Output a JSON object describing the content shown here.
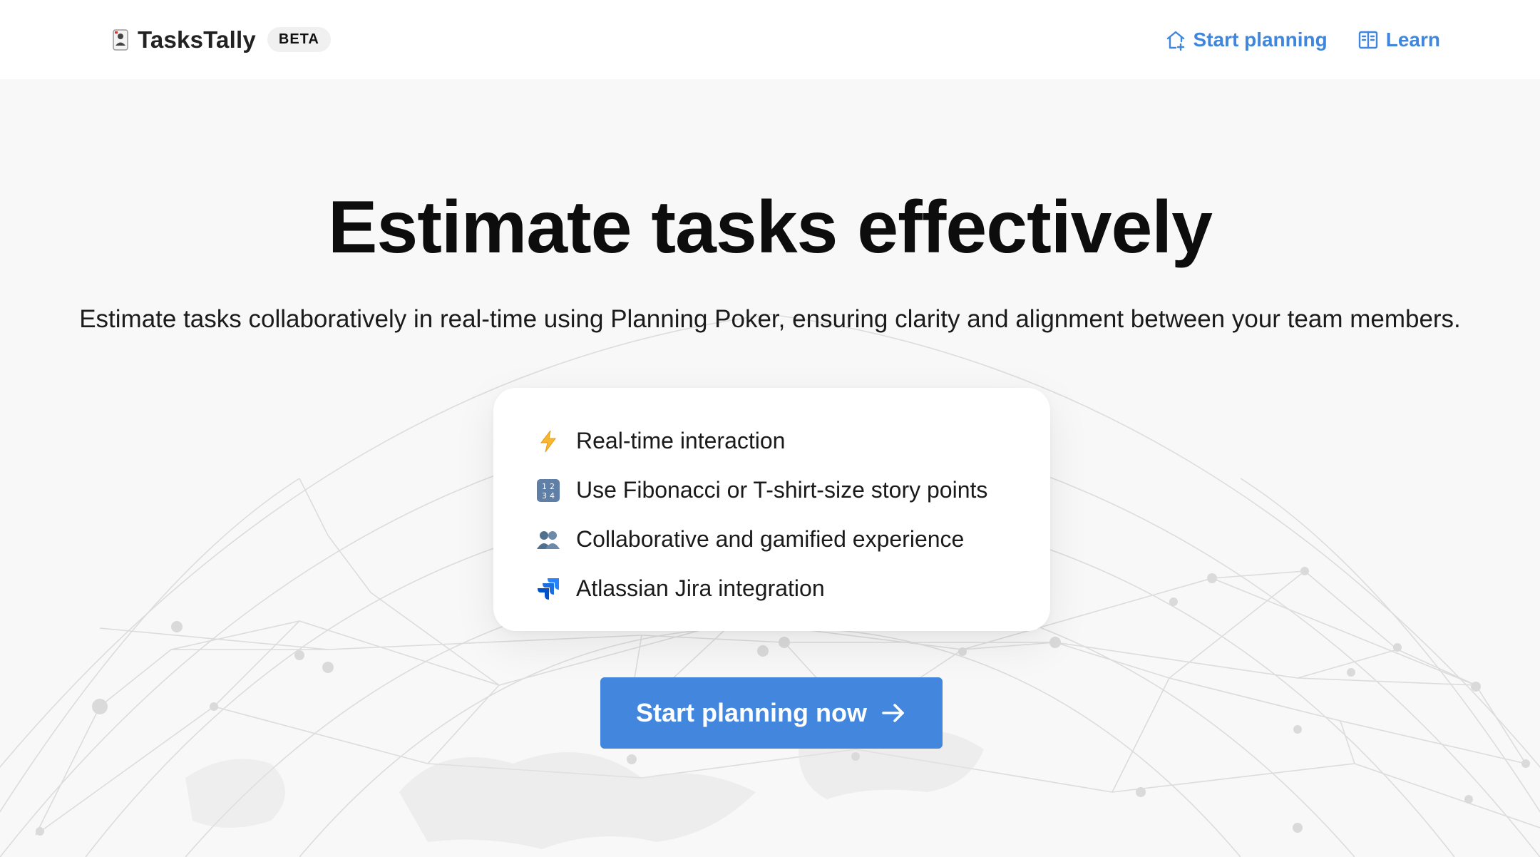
{
  "header": {
    "brand": {
      "logo_icon": "poker-card-icon",
      "name": "TasksTally",
      "badge": "BETA"
    },
    "nav": [
      {
        "label": "Start planning",
        "icon": "house-plus-icon"
      },
      {
        "label": "Learn",
        "icon": "book-icon"
      }
    ]
  },
  "hero": {
    "title": "Estimate tasks effectively",
    "subtitle": "Estimate tasks collaboratively in real-time using Planning Poker, ensuring clarity and alignment between your team members."
  },
  "features": [
    {
      "icon": "lightning-icon",
      "label": "Real-time interaction"
    },
    {
      "icon": "numbers-icon",
      "label": "Use Fibonacci or T-shirt-size story points"
    },
    {
      "icon": "people-icon",
      "label": "Collaborative and gamified experience"
    },
    {
      "icon": "jira-icon",
      "label": "Atlassian Jira integration"
    }
  ],
  "cta": {
    "label": "Start planning now",
    "icon": "arrow-right-icon"
  },
  "colors": {
    "accent": "#4286dd",
    "link": "#3f86dc",
    "background": "#f8f8f8",
    "card": "#ffffff"
  }
}
